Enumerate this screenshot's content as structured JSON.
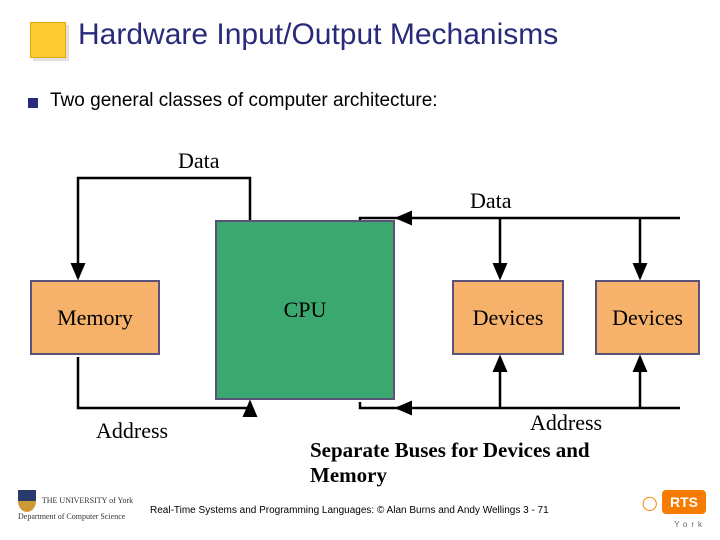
{
  "title": "Hardware Input/Output Mechanisms",
  "bullet": "Two general classes of computer architecture:",
  "labels": {
    "data1": "Data",
    "data2": "Data",
    "address1": "Address",
    "address2": "Address"
  },
  "boxes": {
    "memory": "Memory",
    "cpu": "CPU",
    "devices1": "Devices",
    "devices2": "Devices"
  },
  "caption": "Separate Buses for Devices and Memory",
  "footer": "Real-Time Systems and Programming Languages: © Alan Burns and Andy Wellings 3 - 71",
  "logo_left_line1": "THE UNIVERSITY of York",
  "logo_left_line2": "Department of Computer Science",
  "logo_right_main": "RTS",
  "logo_right_sub": "York",
  "colors": {
    "accent": "#ffcc33",
    "title": "#2a2a7a",
    "memory_fill": "#f6b26b",
    "cpu_fill": "#3aa86f",
    "device_fill": "#f6b26b",
    "box_border": "#5a527a"
  }
}
